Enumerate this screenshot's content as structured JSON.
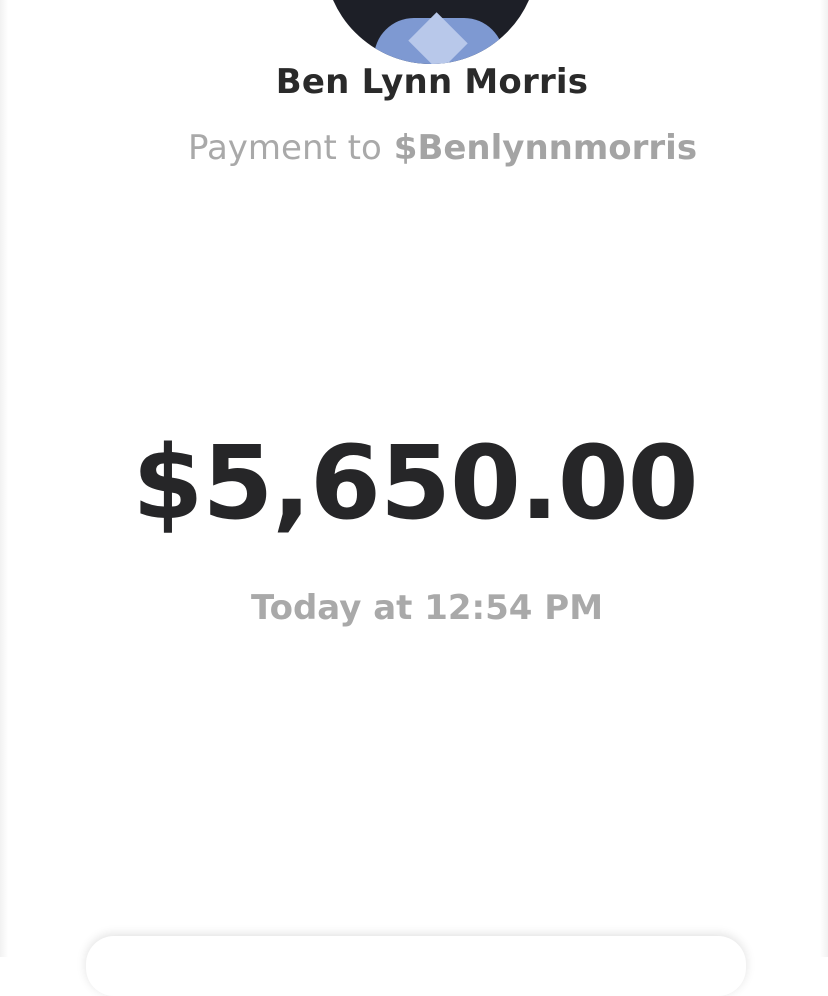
{
  "recipient": {
    "name": "Ben Lynn Morris",
    "payment_prefix": "Payment to",
    "handle": "$Benlynnmorris"
  },
  "transaction": {
    "amount": "$5,650.00",
    "timestamp": "Today at 12:54 PM"
  },
  "colors": {
    "background": "#ffffff",
    "primary_text": "#262628",
    "secondary_text": "#a9a9a9",
    "avatar_dark": "#1d1f27",
    "avatar_shirt": "#7e99d2"
  }
}
